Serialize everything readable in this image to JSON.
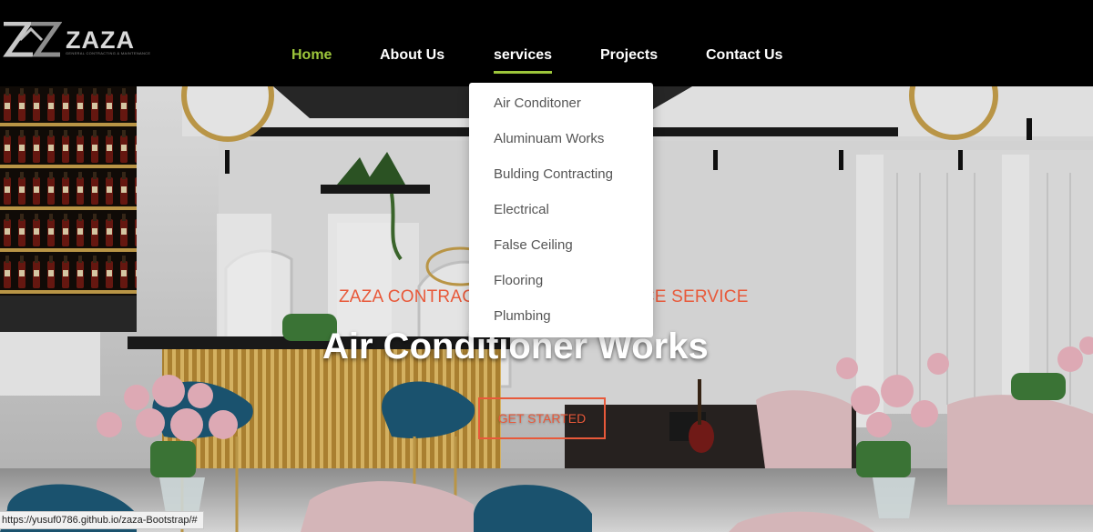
{
  "brand": {
    "name": "ZAZA",
    "tagline": "GENERAL CONTRACTING & MAINTENANCE"
  },
  "nav": {
    "items": [
      {
        "label": "Home",
        "state": "active"
      },
      {
        "label": "About Us"
      },
      {
        "label": "services",
        "state": "open"
      },
      {
        "label": "Projects"
      },
      {
        "label": "Contact Us"
      }
    ]
  },
  "services_menu": [
    "Air Conditoner",
    "Aluminuam Works",
    "Bulding Contracting",
    "Electrical",
    "False Ceiling",
    "Flooring",
    "Plumbing"
  ],
  "hero": {
    "subtitle": "ZAZA CONTRACTING & MAINTENANCE SERVICE",
    "title": "Air Conditioner Works",
    "cta_label": "GET STARTED"
  },
  "status_bar": {
    "url": "https://yusuf0786.github.io/zaza-Bootstrap/#"
  },
  "colors": {
    "accent_green": "#9dc63b",
    "accent_orange": "#e8593a",
    "header_bg": "#000000"
  }
}
